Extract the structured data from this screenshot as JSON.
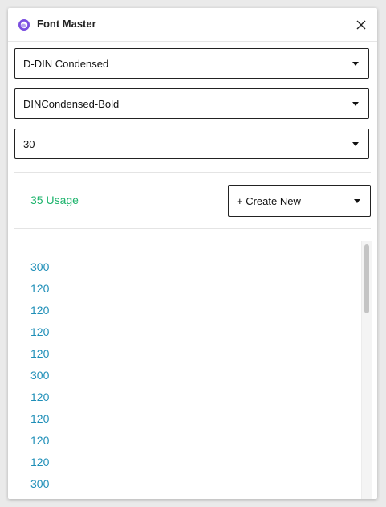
{
  "header": {
    "title": "Font Master",
    "close_label": "close"
  },
  "controls": {
    "font_family": "D-DIN Condensed",
    "font_style": "DINCondensed-Bold",
    "font_size": "30"
  },
  "usage": {
    "count_text": "35 Usage",
    "create_label": "+ Create New"
  },
  "list": {
    "items": [
      "300",
      "120",
      "120",
      "120",
      "120",
      "300",
      "120",
      "120",
      "120",
      "120",
      "300"
    ]
  },
  "colors": {
    "usage_green": "#1bb36b",
    "list_blue": "#1f8fb8",
    "logo_purple": "#7b4fe0"
  },
  "icons": {
    "logo": "font-master-logo-icon",
    "close": "close-icon",
    "dropdown": "chevron-down-icon"
  }
}
